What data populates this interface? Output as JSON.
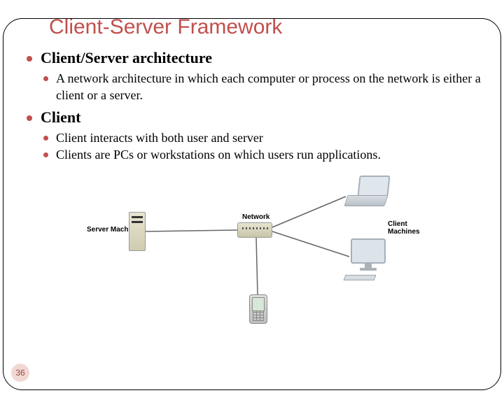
{
  "title": "Client-Server Framework",
  "sections": [
    {
      "heading": "Client/Server architecture",
      "items": [
        "A network architecture in which each computer or process on the network is either a client or a server."
      ]
    },
    {
      "heading": "Client",
      "items": [
        "Client interacts with both user and server",
        "Clients are PCs or workstations on which users run applications."
      ]
    }
  ],
  "diagram": {
    "server_label": "Server Machine",
    "network_label": "Network",
    "clients_label": "Client Machines"
  },
  "slide_number": "36"
}
